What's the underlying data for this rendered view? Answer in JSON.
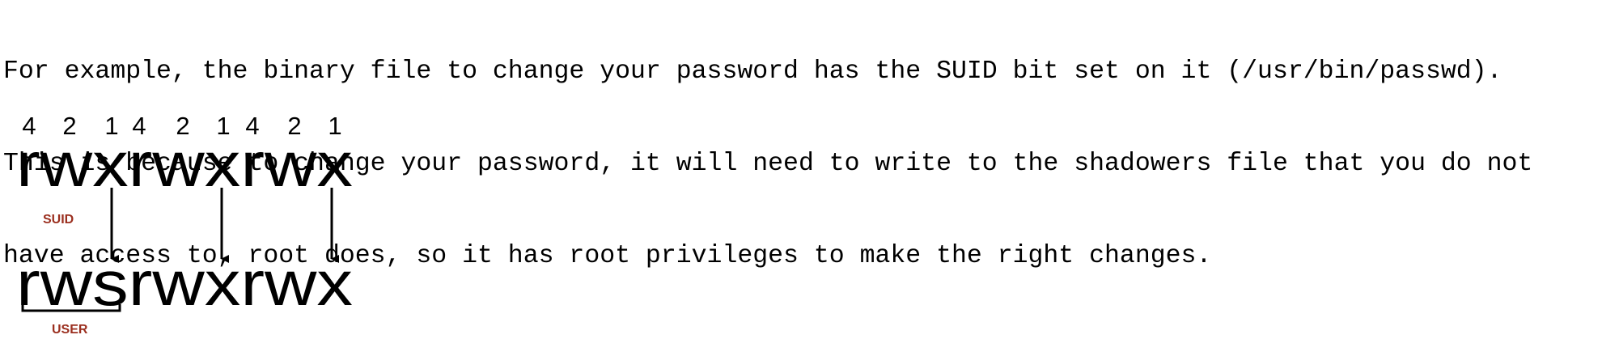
{
  "paragraph": {
    "lines": [
      "For example, the binary file to change your password has the SUID bit set on it (/usr/bin/passwd).",
      "This is because to change your password, it will need to write to the shadowers file that you do not",
      "have access to, root does, so it has root privileges to make the right changes."
    ]
  },
  "diagram": {
    "weights": [
      "4",
      "2",
      "1",
      "4",
      "2",
      "1",
      "4",
      "2",
      "1"
    ],
    "before": "rwxrwxrwx",
    "after": "rwsrwxrwx",
    "suid_label": "SUID",
    "user_label": "USER",
    "label_color": "#9b2f1f"
  }
}
